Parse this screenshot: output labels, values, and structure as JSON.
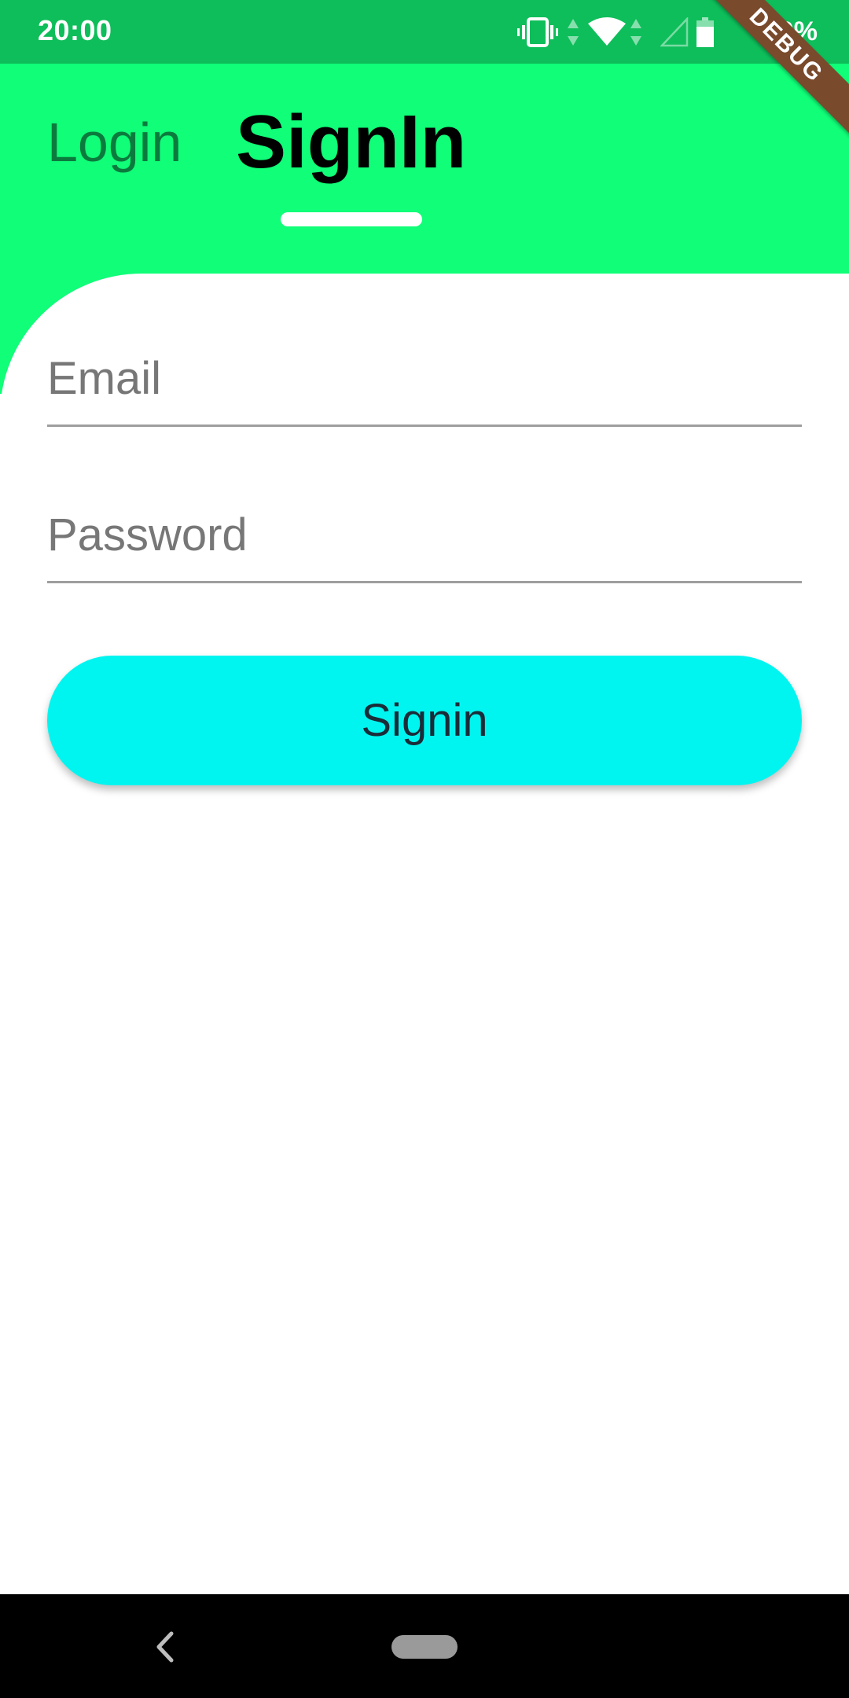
{
  "status_bar": {
    "time": "20:00",
    "battery": "80%",
    "icons": [
      "vibrate-icon",
      "data-arrows-icon",
      "wifi-icon",
      "signal-icon",
      "battery-icon"
    ]
  },
  "debug_banner": "DEBUG",
  "tabs": {
    "login": "Login",
    "signin": "SignIn"
  },
  "form": {
    "email_placeholder": "Email",
    "password_placeholder": "Password",
    "submit_label": "Signin"
  },
  "colors": {
    "status_bar": "#0ebe5a",
    "header": "#10fe78",
    "button": "#00f5f0",
    "debug_ribbon": "#7a4a2c"
  }
}
